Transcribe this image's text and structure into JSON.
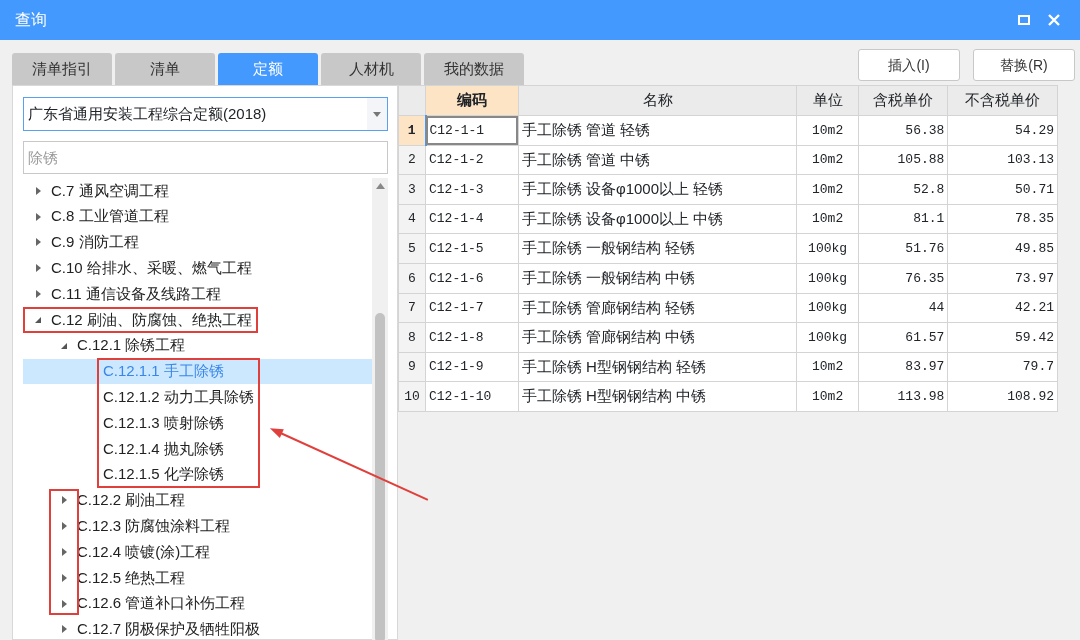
{
  "window": {
    "title": "查询"
  },
  "tabs": [
    {
      "label": "清单指引",
      "selected": false
    },
    {
      "label": "清单",
      "selected": false
    },
    {
      "label": "定额",
      "selected": true
    },
    {
      "label": "人材机",
      "selected": false
    },
    {
      "label": "我的数据",
      "selected": false
    }
  ],
  "buttons": [
    "插入(I)",
    "替换(R)"
  ],
  "library_select": {
    "value": "广东省通用安装工程综合定额(2018)"
  },
  "search": {
    "placeholder": "除锈"
  },
  "tree": {
    "pointer_arrow": true,
    "items": [
      {
        "label": "C.7 通风空调工程",
        "expanded": false,
        "selected": false,
        "framed": false,
        "toggle_framed": false
      },
      {
        "label": "C.8 工业管道工程",
        "expanded": false,
        "selected": false,
        "framed": false,
        "toggle_framed": false
      },
      {
        "label": "C.9 消防工程",
        "expanded": false,
        "selected": false,
        "framed": false,
        "toggle_framed": false
      },
      {
        "label": "C.10 给排水、采暖、燃气工程",
        "expanded": false,
        "selected": false,
        "framed": false,
        "toggle_framed": false
      },
      {
        "label": "C.11 通信设备及线路工程",
        "expanded": false,
        "selected": false,
        "framed": false,
        "toggle_framed": false
      },
      {
        "label": "C.12 刷油、防腐蚀、绝热工程",
        "expanded": true,
        "selected": false,
        "framed": true,
        "toggle_framed": false,
        "children": [
          {
            "label": "C.12.1 除锈工程",
            "expanded": true,
            "selected": false,
            "framed": false,
            "toggle_framed": false,
            "children": [
              {
                "label": "C.12.1.1 手工除锈",
                "selected": true,
                "framed": true
              },
              {
                "label": "C.12.1.2 动力工具除锈",
                "selected": false,
                "framed": true
              },
              {
                "label": "C.12.1.3 喷射除锈",
                "selected": false,
                "framed": true
              },
              {
                "label": "C.12.1.4 抛丸除锈",
                "selected": false,
                "framed": true
              },
              {
                "label": "C.12.1.5 化学除锈",
                "selected": false,
                "framed": true
              }
            ]
          },
          {
            "label": "C.12.2 刷油工程",
            "expanded": false,
            "selected": false,
            "framed": false,
            "toggle_framed": true
          },
          {
            "label": "C.12.3 防腐蚀涂料工程",
            "expanded": false,
            "selected": false,
            "framed": false,
            "toggle_framed": true
          },
          {
            "label": "C.12.4 喷镀(涂)工程",
            "expanded": false,
            "selected": false,
            "framed": false,
            "toggle_framed": true
          },
          {
            "label": "C.12.5 绝热工程",
            "expanded": false,
            "selected": false,
            "framed": false,
            "toggle_framed": true
          },
          {
            "label": "C.12.6 管道补口补伤工程",
            "expanded": false,
            "selected": false,
            "framed": false,
            "toggle_framed": true
          },
          {
            "label": "C.12.7 阴极保护及牺牲阳极",
            "expanded": false,
            "selected": false,
            "framed": false,
            "toggle_framed": false
          }
        ]
      }
    ]
  },
  "table": {
    "columns": [
      {
        "label": "编码",
        "selected": true
      },
      {
        "label": "名称",
        "selected": false
      },
      {
        "label": "单位",
        "selected": false
      },
      {
        "label": "含税单价",
        "selected": false
      },
      {
        "label": "不含税单价",
        "selected": false
      }
    ],
    "rows": [
      {
        "number": "1",
        "selected": true,
        "cells": [
          "C12-1-1",
          "手工除锈 管道 轻锈",
          "10m2",
          "56.38",
          "54.29"
        ]
      },
      {
        "number": "2",
        "selected": false,
        "cells": [
          "C12-1-2",
          "手工除锈 管道 中锈",
          "10m2",
          "105.88",
          "103.13"
        ]
      },
      {
        "number": "3",
        "selected": false,
        "cells": [
          "C12-1-3",
          "手工除锈 设备φ1000以上 轻锈",
          "10m2",
          "52.8",
          "50.71"
        ]
      },
      {
        "number": "4",
        "selected": false,
        "cells": [
          "C12-1-4",
          "手工除锈 设备φ1000以上 中锈",
          "10m2",
          "81.1",
          "78.35"
        ]
      },
      {
        "number": "5",
        "selected": false,
        "cells": [
          "C12-1-5",
          "手工除锈 一般钢结构 轻锈",
          "100kg",
          "51.76",
          "49.85"
        ]
      },
      {
        "number": "6",
        "selected": false,
        "cells": [
          "C12-1-6",
          "手工除锈 一般钢结构 中锈",
          "100kg",
          "76.35",
          "73.97"
        ]
      },
      {
        "number": "7",
        "selected": false,
        "cells": [
          "C12-1-7",
          "手工除锈 管廊钢结构 轻锈",
          "100kg",
          "44",
          "42.21"
        ]
      },
      {
        "number": "8",
        "selected": false,
        "cells": [
          "C12-1-8",
          "手工除锈 管廊钢结构 中锈",
          "100kg",
          "61.57",
          "59.42"
        ]
      },
      {
        "number": "9",
        "selected": false,
        "cells": [
          "C12-1-9",
          "手工除锈 H型钢钢结构 轻锈",
          "10m2",
          "83.97",
          "79.7"
        ]
      },
      {
        "number": "10",
        "selected": false,
        "cells": [
          "C12-1-10",
          "手工除锈 H型钢钢结构 中锈",
          "10m2",
          "113.98",
          "108.92"
        ]
      }
    ]
  }
}
